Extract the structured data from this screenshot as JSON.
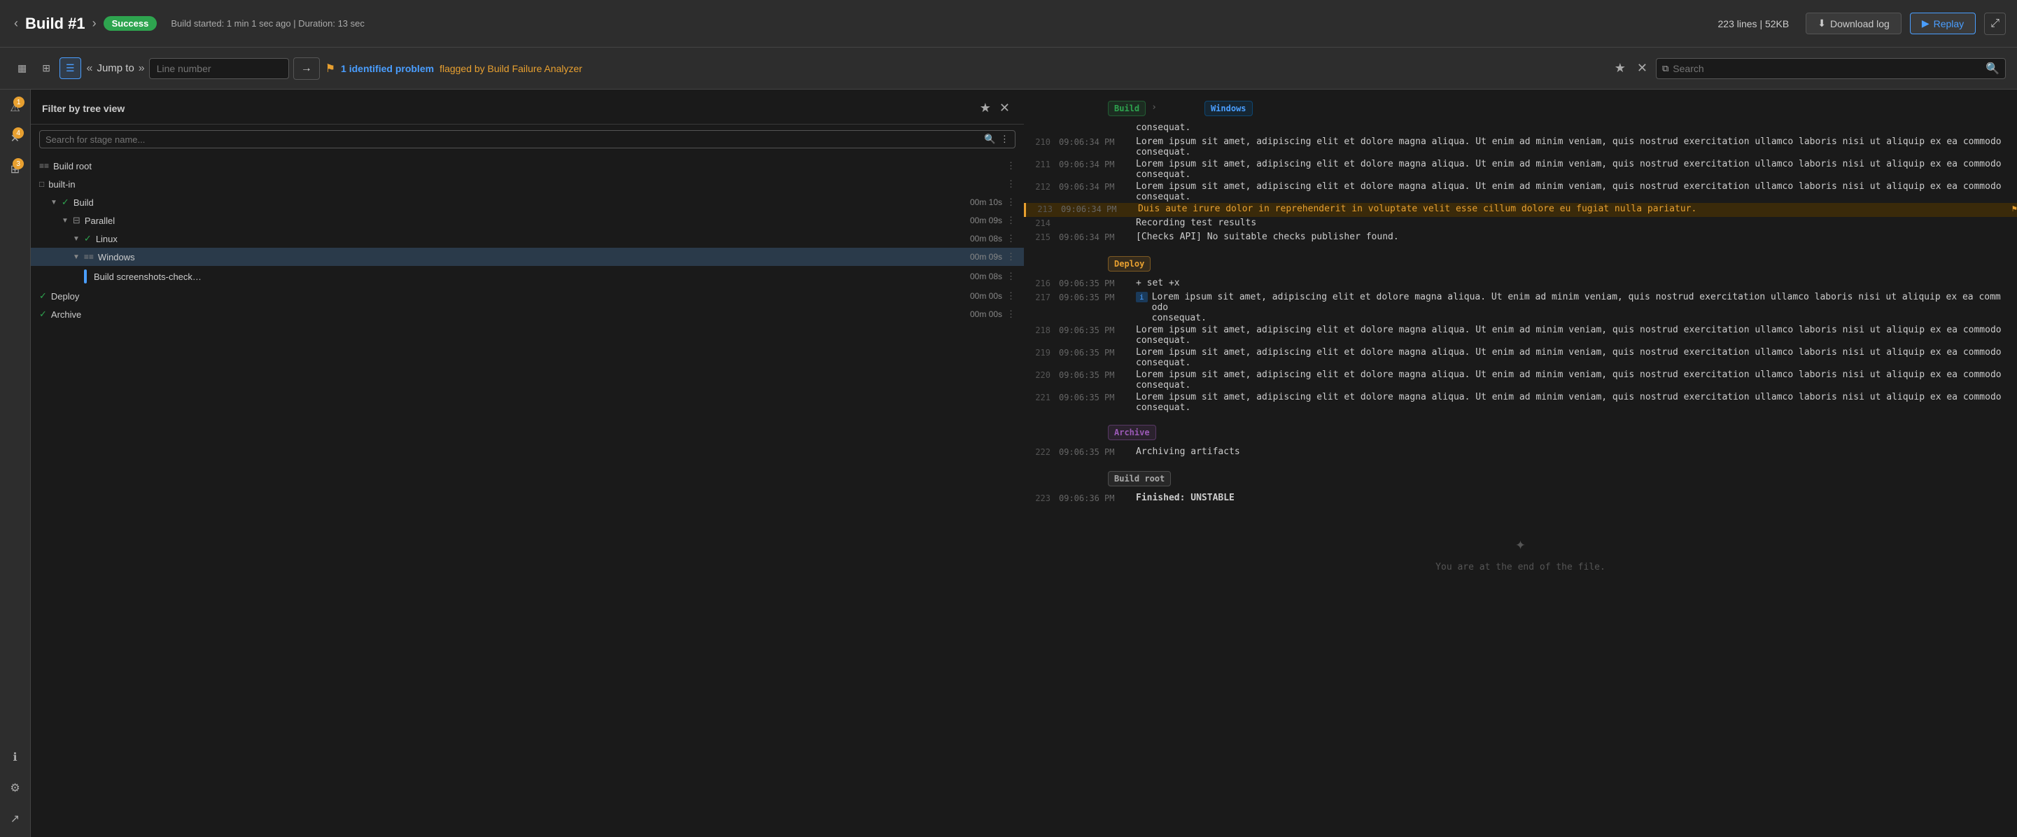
{
  "header": {
    "prev_label": "‹",
    "next_label": "›",
    "title": "Build #1",
    "badge": "Success",
    "meta": "Build started: 1 min 1 sec ago  |  Duration: 13 sec",
    "stats": "223 lines  |  52KB",
    "download_label": "Download log",
    "replay_label": "Replay",
    "expand_label": "⤢"
  },
  "toolbar": {
    "icon1": "▦",
    "icon2": "⊞",
    "icon3": "☰",
    "jump_label": "Jump to",
    "jump_placeholder": "Line number",
    "go_icon": "→",
    "problem_count": "1 identified problem",
    "problem_suffix": " flagged by Build Failure Analyzer",
    "star_icon": "★",
    "close_icon": "✕",
    "search_placeholder": "Search",
    "filter_icon": "⧉"
  },
  "sidebar": {
    "filter_title": "Filter by tree view",
    "search_placeholder": "Search for stage name...",
    "items": [
      {
        "id": "build-root",
        "label": "Build root",
        "indent": 0,
        "icon": "grid",
        "time": ""
      },
      {
        "id": "built-in",
        "label": "built-in",
        "indent": 0,
        "icon": "box",
        "time": ""
      },
      {
        "id": "build",
        "label": "Build",
        "indent": 1,
        "icon": "check",
        "time": "00m 10s"
      },
      {
        "id": "parallel",
        "label": "Parallel",
        "indent": 2,
        "icon": "parallel",
        "time": "00m 09s"
      },
      {
        "id": "linux",
        "label": "Linux",
        "indent": 3,
        "icon": "check",
        "time": "00m 08s"
      },
      {
        "id": "windows",
        "label": "Windows",
        "indent": 3,
        "icon": "expand",
        "time": "00m 09s"
      },
      {
        "id": "build-screenshots",
        "label": "Build screenshots-check…",
        "indent": 4,
        "icon": "bar",
        "time": "00m 08s"
      },
      {
        "id": "deploy",
        "label": "Deploy",
        "indent": 0,
        "icon": "check",
        "time": "00m 00s"
      },
      {
        "id": "archive",
        "label": "Archive",
        "indent": 0,
        "icon": "check",
        "time": "00m 00s"
      }
    ],
    "icon_info": "ℹ",
    "icon_warning_badge": "1",
    "icon_cross": "✕",
    "icon_cross_badge": "4",
    "icon_grid2": "⊞",
    "icon_grid2_badge": "3",
    "icon_link": "⚙",
    "icon_info2": "ℹ",
    "icon_settings": "⚙",
    "icon_share": "↗"
  },
  "log": {
    "sections": [
      {
        "type": "build_windows",
        "labels": [
          "Build",
          "Windows"
        ]
      }
    ],
    "lines": [
      {
        "num": "",
        "time": "",
        "content": "consequat.",
        "highlighted": false,
        "info": false
      },
      {
        "num": "210",
        "time": "09:06:34 PM",
        "content": "Lorem ipsum sit amet, adipiscing elit et dolore magna aliqua. Ut enim ad minim veniam, quis nostrud exercitation ullamco laboris nisi ut aliquip ex ea commodo\nconsequat.",
        "highlighted": false,
        "info": false
      },
      {
        "num": "211",
        "time": "09:06:34 PM",
        "content": "Lorem ipsum sit amet, adipiscing elit et dolore magna aliqua. Ut enim ad minim veniam, quis nostrud exercitation ullamco laboris nisi ut aliquip ex ea commodo\nconsequat.",
        "highlighted": false,
        "info": false
      },
      {
        "num": "212",
        "time": "09:06:34 PM",
        "content": "Lorem ipsum sit amet, adipiscing elit et dolore magna aliqua. Ut enim ad minim veniam, quis nostrud exercitation ullamco laboris nisi ut aliquip ex ea commodo\nconsequat.",
        "highlighted": false,
        "info": false
      },
      {
        "num": "213",
        "time": "09:06:34 PM",
        "content": "Duis aute irure dolor in reprehenderit in voluptate velit esse cillum dolore eu fugiat nulla pariatur.",
        "highlighted": true,
        "flag": true,
        "info": false
      },
      {
        "num": "214",
        "time": "",
        "content": "Recording test results",
        "highlighted": false,
        "info": false
      },
      {
        "num": "215",
        "time": "09:06:34 PM",
        "content": "[Checks API] No suitable checks publisher found.",
        "highlighted": false,
        "info": false
      }
    ],
    "deploy_section_label": "Deploy",
    "deploy_lines": [
      {
        "num": "216",
        "time": "09:06:35 PM",
        "content": "+ set +x",
        "highlighted": false,
        "info": false
      },
      {
        "num": "217",
        "time": "09:06:35 PM",
        "content": "Lorem ipsum sit amet, adipiscing elit et dolore magna aliqua. Ut enim ad minim veniam, quis nostrud exercitation ullamco laboris nisi ut aliquip ex ea commodo\nconsequat.",
        "highlighted": false,
        "info": true
      },
      {
        "num": "218",
        "time": "09:06:35 PM",
        "content": "Lorem ipsum sit amet, adipiscing elit et dolore magna aliqua. Ut enim ad minim veniam, quis nostrud exercitation ullamco laboris nisi ut aliquip ex ea commodo\nconsequat.",
        "highlighted": false,
        "info": false
      },
      {
        "num": "219",
        "time": "09:06:35 PM",
        "content": "Lorem ipsum sit amet, adipiscing elit et dolore magna aliqua. Ut enim ad minim veniam, quis nostrud exercitation ullamco laboris nisi ut aliquip ex ea commodo\nconsequat.",
        "highlighted": false,
        "info": false
      },
      {
        "num": "220",
        "time": "09:06:35 PM",
        "content": "Lorem ipsum sit amet, adipiscing elit et dolore magna aliqua. Ut enim ad minim veniam, quis nostrud exercitation ullamco laboris nisi ut aliquip ex ea commodo\nconsequat.",
        "highlighted": false,
        "info": false
      },
      {
        "num": "221",
        "time": "09:06:35 PM",
        "content": "Lorem ipsum sit amet, adipiscing elit et dolore magna aliqua. Ut enim ad minim veniam, quis nostrud exercitation ullamco laboris nisi ut aliquip ex ea commodo\nconsequat.",
        "highlighted": false,
        "info": false
      }
    ],
    "archive_lines": [
      {
        "num": "222",
        "time": "09:06:35 PM",
        "content": "Archiving artifacts",
        "highlighted": false
      }
    ],
    "buildroot_lines": [
      {
        "num": "223",
        "time": "09:06:36 PM",
        "content": "Finished: UNSTABLE",
        "highlighted": false
      }
    ],
    "end_sparkle": "✦",
    "end_text": "You are at the end of the file."
  },
  "colors": {
    "success": "#2ea44f",
    "accent": "#4a9eff",
    "warning": "#e8a030",
    "bg": "#1a1a1a",
    "sidebar_bg": "#252525"
  }
}
